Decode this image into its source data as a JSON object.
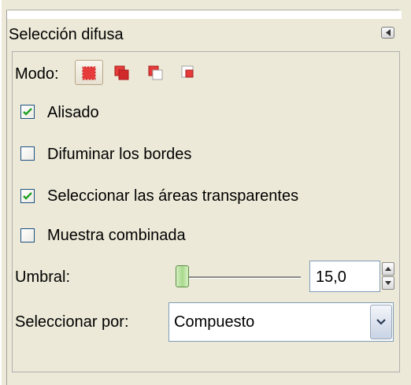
{
  "panel": {
    "title": "Selección difusa"
  },
  "mode": {
    "label": "Modo:",
    "buttons": [
      "replace-selection",
      "add-to-selection",
      "subtract-from-selection",
      "intersect-with-selection"
    ]
  },
  "options": {
    "antialiasing": {
      "label": "Alisado",
      "checked": true
    },
    "feather_edges": {
      "label": "Difuminar los bordes",
      "checked": false
    },
    "select_transparent": {
      "label": "Seleccionar las áreas transparentes",
      "checked": true
    },
    "sample_merged": {
      "label": "Muestra combinada",
      "checked": false
    }
  },
  "threshold": {
    "label": "Umbral:",
    "value": "15,0"
  },
  "select_by": {
    "label": "Seleccionar por:",
    "value": "Compuesto"
  },
  "colors": {
    "checkmark": "#21a121",
    "mode_red": "#e53b3b",
    "panel_bg": "#ece9d8"
  }
}
